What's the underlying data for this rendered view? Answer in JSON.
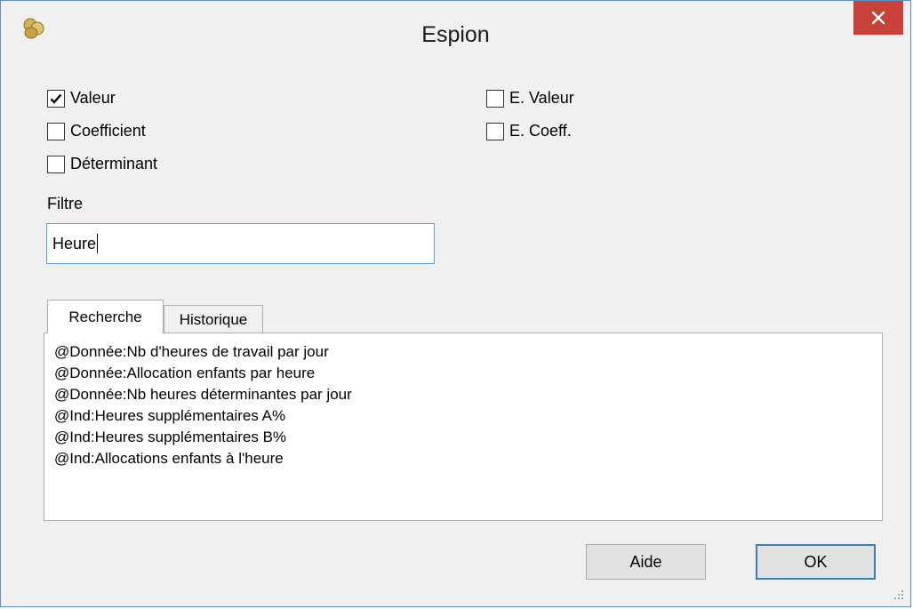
{
  "window": {
    "title": "Espion",
    "app_icon": "gold-coins-icon",
    "close_icon": "close-icon",
    "close_color": "#c7403a"
  },
  "options": {
    "valeur": {
      "label": "Valeur",
      "checked": true
    },
    "coefficient": {
      "label": "Coefficient",
      "checked": false
    },
    "determinant": {
      "label": "Déterminant",
      "checked": false
    },
    "e_valeur": {
      "label": "E. Valeur",
      "checked": false
    },
    "e_coeff": {
      "label": "E. Coeff.",
      "checked": false
    }
  },
  "filter": {
    "label": "Filtre",
    "value": "Heure"
  },
  "tabs": {
    "recherche": "Recherche",
    "historique": "Historique",
    "active": "Recherche"
  },
  "results": [
    "@Donnée:Nb d'heures de travail par jour",
    "@Donnée:Allocation enfants par heure",
    "@Donnée:Nb heures déterminantes par jour",
    "@Ind:Heures supplémentaires A%",
    "@Ind:Heures supplémentaires B%",
    "@Ind:Allocations enfants à l'heure"
  ],
  "buttons": {
    "aide": "Aide",
    "ok": "OK"
  }
}
